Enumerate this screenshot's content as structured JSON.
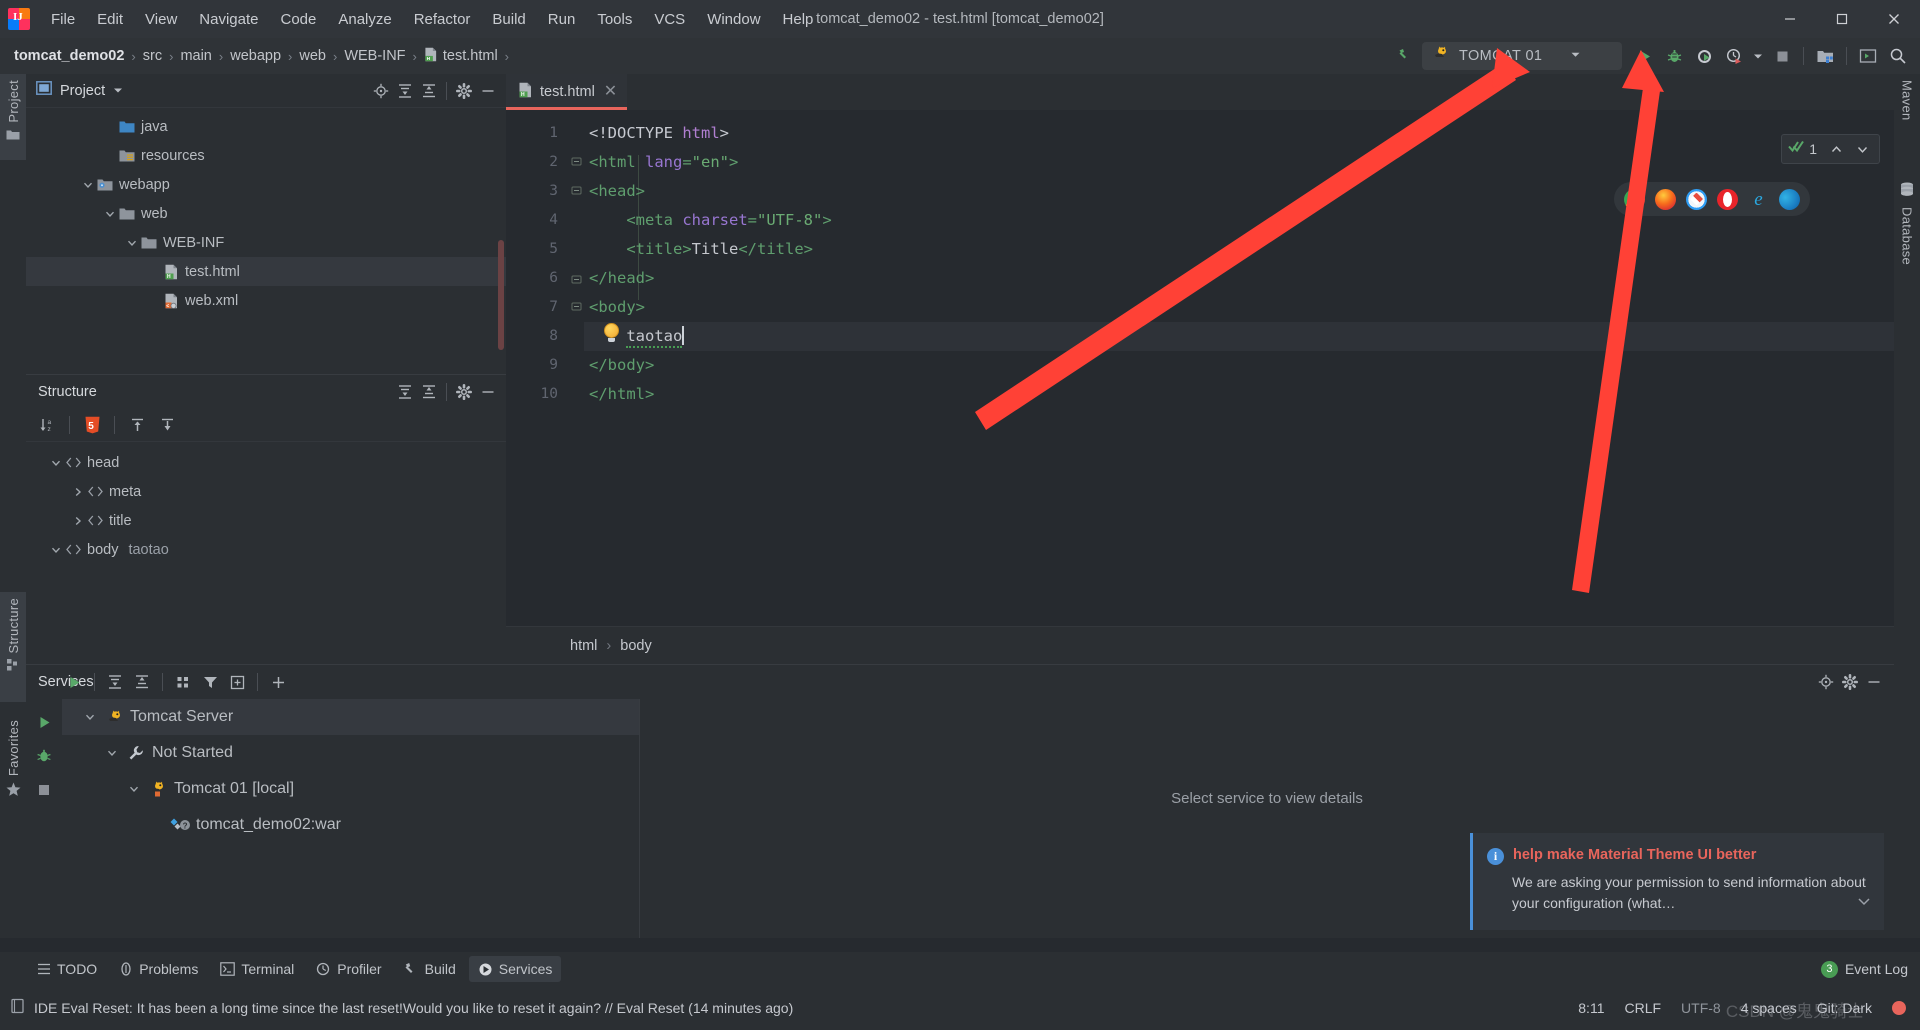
{
  "window": {
    "title": "tomcat_demo02 - test.html [tomcat_demo02]",
    "minimize_icon": "minimize-icon",
    "maximize_icon": "maximize-icon",
    "close_icon": "close-icon"
  },
  "menubar": {
    "items": [
      {
        "label": "File",
        "mnemonic": "F"
      },
      {
        "label": "Edit",
        "mnemonic": "E"
      },
      {
        "label": "View",
        "mnemonic": "V"
      },
      {
        "label": "Navigate",
        "mnemonic": "N"
      },
      {
        "label": "Code",
        "mnemonic": "C"
      },
      {
        "label": "Analyze",
        "mnemonic": "z"
      },
      {
        "label": "Refactor",
        "mnemonic": "R"
      },
      {
        "label": "Build",
        "mnemonic": "B"
      },
      {
        "label": "Run",
        "mnemonic": "u"
      },
      {
        "label": "Tools",
        "mnemonic": "T"
      },
      {
        "label": "VCS",
        "mnemonic": ""
      },
      {
        "label": "Window",
        "mnemonic": "W"
      },
      {
        "label": "Help",
        "mnemonic": "H"
      }
    ]
  },
  "breadcrumb": {
    "items": [
      "tomcat_demo02",
      "src",
      "main",
      "webapp",
      "web",
      "WEB-INF",
      "test.html"
    ],
    "separator": "›"
  },
  "run_toolbar": {
    "build_icon": "hammer-icon",
    "config_name": "TOMCAT 01",
    "config_icon": "tomcat-icon",
    "dropdown_icon": "chevron-down-icon",
    "run_icon": "run-icon",
    "debug_icon": "debug-icon",
    "run_coverage_icon": "run-with-coverage-icon",
    "profile_icon": "profiler-icon",
    "profile_dropdown_icon": "chevron-down-icon",
    "stop_icon": "stop-icon",
    "project_structure_icon": "project-structure-icon",
    "terminal_icon": "terminal-icon",
    "search_everywhere_icon": "search-icon"
  },
  "left_strip": {
    "items": [
      {
        "label": "Project",
        "icon": "project-icon",
        "active": true
      },
      {
        "label": "Structure",
        "icon": "structure-icon",
        "active": true
      },
      {
        "label": "Favorites",
        "icon": "star-icon",
        "active": false
      }
    ]
  },
  "right_strip": {
    "items": [
      {
        "label": "Maven",
        "icon": "maven-icon"
      },
      {
        "label": "Database",
        "icon": "database-icon"
      }
    ]
  },
  "project_panel": {
    "title": "Project",
    "dropdown_icon": "chevron-down-icon",
    "view_icon": "project-view-icon",
    "actions": [
      "locate-icon",
      "expand-all-icon",
      "collapse-all-icon",
      "settings-icon",
      "hide-icon"
    ],
    "tree": [
      {
        "label": "java",
        "indent": 3,
        "arrow": "none",
        "icon": "source-folder-icon",
        "selected": false
      },
      {
        "label": "resources",
        "indent": 3,
        "arrow": "none",
        "icon": "resources-folder-icon",
        "selected": false
      },
      {
        "label": "webapp",
        "indent": 2,
        "arrow": "expanded",
        "icon": "webapp-folder-icon",
        "selected": false
      },
      {
        "label": "web",
        "indent": 3,
        "arrow": "expanded",
        "icon": "folder-icon",
        "selected": false
      },
      {
        "label": "WEB-INF",
        "indent": 4,
        "arrow": "expanded",
        "icon": "folder-icon",
        "selected": false
      },
      {
        "label": "test.html",
        "indent": 5,
        "arrow": "none",
        "icon": "html-file-icon",
        "selected": true
      },
      {
        "label": "web.xml",
        "indent": 5,
        "arrow": "none",
        "icon": "xml-file-icon",
        "selected": false
      }
    ]
  },
  "structure_panel": {
    "title": "Structure",
    "actions": [
      "expand-all-icon",
      "collapse-all-icon",
      "settings-icon",
      "hide-icon"
    ],
    "toolbar": [
      "sort-alphabetically-icon",
      "html5-icon",
      "scroll-from-source-icon",
      "scroll-to-source-icon"
    ],
    "tree": [
      {
        "label": "head",
        "extra": "",
        "indent": 0,
        "arrow": "expanded",
        "icon": "tag-icon"
      },
      {
        "label": "meta",
        "extra": "",
        "indent": 1,
        "arrow": "collapsed",
        "icon": "tag-icon"
      },
      {
        "label": "title",
        "extra": "",
        "indent": 1,
        "arrow": "collapsed",
        "icon": "tag-icon"
      },
      {
        "label": "body",
        "extra": "taotao",
        "indent": 0,
        "arrow": "expanded",
        "icon": "tag-icon"
      }
    ]
  },
  "editor": {
    "tab": {
      "label": "test.html",
      "icon": "html-file-icon",
      "close_icon": "close-icon"
    },
    "lines": [
      {
        "num": "1",
        "fold": "none",
        "tokens": [
          {
            "t": "<!DOCTYPE ",
            "c": "k-doctype"
          },
          {
            "t": "html",
            "c": "k-html"
          },
          {
            "t": ">",
            "c": "k-doctype"
          }
        ]
      },
      {
        "num": "2",
        "fold": "open",
        "tokens": [
          {
            "t": "<html ",
            "c": "k-tag"
          },
          {
            "t": "lang",
            "c": "k-attr"
          },
          {
            "t": "=",
            "c": "k-tag"
          },
          {
            "t": "\"en\"",
            "c": "k-str"
          },
          {
            "t": ">",
            "c": "k-tag"
          }
        ]
      },
      {
        "num": "3",
        "fold": "open",
        "tokens": [
          {
            "t": "<head>",
            "c": "k-tag"
          }
        ]
      },
      {
        "num": "4",
        "fold": "none",
        "tokens": [
          {
            "t": "    <meta ",
            "c": "k-tag"
          },
          {
            "t": "charset",
            "c": "k-attr"
          },
          {
            "t": "=",
            "c": "k-tag"
          },
          {
            "t": "\"UTF-8\"",
            "c": "k-str"
          },
          {
            "t": ">",
            "c": "k-tag"
          }
        ]
      },
      {
        "num": "5",
        "fold": "none",
        "tokens": [
          {
            "t": "    <title>",
            "c": "k-tag"
          },
          {
            "t": "Title",
            "c": "k-txt"
          },
          {
            "t": "</title>",
            "c": "k-tag"
          }
        ]
      },
      {
        "num": "6",
        "fold": "close",
        "tokens": [
          {
            "t": "</head>",
            "c": "k-tag"
          }
        ]
      },
      {
        "num": "7",
        "fold": "open",
        "tokens": [
          {
            "t": "<body>",
            "c": "k-tag"
          }
        ]
      },
      {
        "num": "8",
        "fold": "none",
        "current": true,
        "tokens": [
          {
            "t": "    ",
            "c": "k-txt"
          },
          {
            "t": "taotao",
            "c": "k-txt typo"
          }
        ],
        "caret": true
      },
      {
        "num": "9",
        "fold": "none",
        "tokens": [
          {
            "t": "</body>",
            "c": "k-tag"
          }
        ]
      },
      {
        "num": "10",
        "fold": "none",
        "tokens": [
          {
            "t": "</html>",
            "c": "k-tag"
          }
        ]
      }
    ],
    "bulb_icon": "intention-bulb-icon",
    "breadcrumbs": [
      "html",
      "body"
    ],
    "breadcrumb_separator": "›"
  },
  "inspections": {
    "count": "1",
    "status_icon": "inspection-ok-icon",
    "prev_icon": "chevron-up-icon",
    "next_icon": "chevron-down-icon"
  },
  "browsers": [
    {
      "name": "chrome-icon"
    },
    {
      "name": "firefox-icon"
    },
    {
      "name": "safari-icon"
    },
    {
      "name": "opera-icon"
    },
    {
      "name": "internet-explorer-icon"
    },
    {
      "name": "edge-icon"
    }
  ],
  "services": {
    "title": "Services",
    "actions": [
      "locate-icon",
      "settings-icon",
      "hide-icon"
    ],
    "toolbar": [
      "run-icon",
      "expand-all-icon",
      "collapse-all-icon",
      "group-icon",
      "filter-icon",
      "add-service-icon",
      "add-icon"
    ],
    "sidebar": [
      "run-icon",
      "debug-icon",
      "stop-icon"
    ],
    "tree": [
      {
        "label": "Tomcat Server",
        "indent": 0,
        "arrow": "expanded",
        "icon": "tomcat-icon",
        "selected": true
      },
      {
        "label": "Not Started",
        "indent": 1,
        "arrow": "expanded",
        "icon": "wrench-icon",
        "selected": false
      },
      {
        "label": "Tomcat 01 [local]",
        "indent": 2,
        "arrow": "expanded",
        "icon": "tomcat-stopped-icon",
        "selected": false
      },
      {
        "label": "tomcat_demo02:war",
        "indent": 3,
        "arrow": "none",
        "icon": "artifact-icon",
        "selected": false
      }
    ],
    "detail_message": "Select service to view details"
  },
  "notification": {
    "icon": "info-icon",
    "title": "help make Material Theme UI better",
    "body": "We are asking your permission to send information about your configuration (what…",
    "expand_icon": "chevron-down-icon"
  },
  "bottom_bar": {
    "items": [
      {
        "label": "TODO",
        "icon": "todo-icon",
        "active": false
      },
      {
        "label": "Problems",
        "icon": "problems-icon",
        "active": false
      },
      {
        "label": "Terminal",
        "icon": "terminal-icon",
        "active": false
      },
      {
        "label": "Profiler",
        "icon": "profiler-icon",
        "active": false
      },
      {
        "label": "Build",
        "icon": "hammer-icon",
        "active": false
      },
      {
        "label": "Services",
        "icon": "services-icon",
        "active": true
      }
    ],
    "event_log": {
      "label": "Event Log",
      "badge": "3"
    }
  },
  "statusbar": {
    "message_icon": "notification-icon",
    "message": "IDE Eval Reset: It has been a long time since the last reset!Would you like to reset it again? // Eval Reset (14 minutes ago)",
    "caret_position": "8:11",
    "line_separator": "CRLF",
    "encoding": "UTF-8",
    "indent": "4 spaces",
    "branch": "Git: Dark",
    "dot_icon": "status-dot-icon"
  },
  "watermark": "CSDN @鬼鬼骑士",
  "colors": {
    "accent_red": "#e8655c",
    "green_run": "#59a869",
    "tab_underline": "#e8655c",
    "info_blue": "#4a90d9",
    "bg_main": "#262a2f",
    "bg_panel": "#2b2f33"
  }
}
